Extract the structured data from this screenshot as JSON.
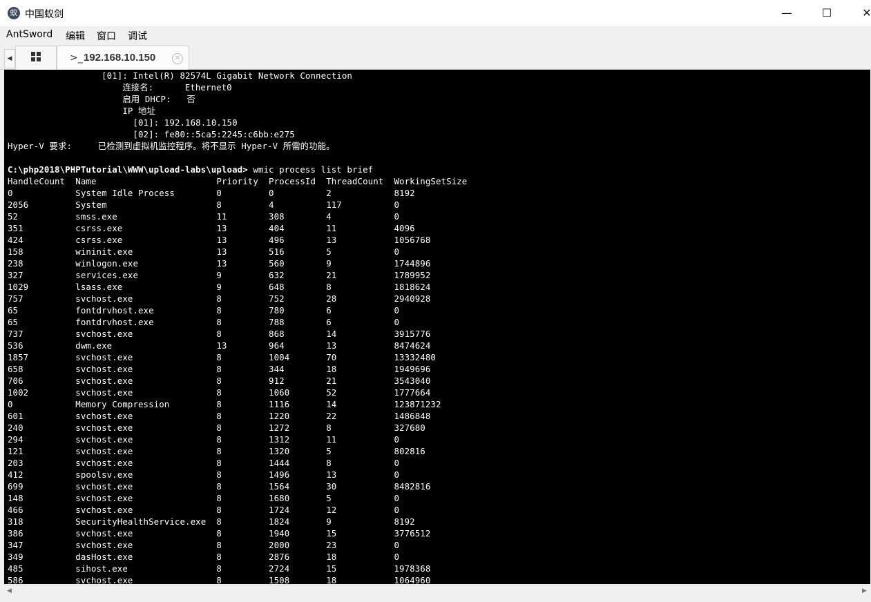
{
  "window": {
    "title": "中国蚁剑",
    "app_icon": "antsword-logo-icon",
    "minimize": "—",
    "maximize": "☐",
    "close": "✕"
  },
  "menu": [
    "AntSword",
    "编辑",
    "窗口",
    "调试"
  ],
  "tabs": {
    "scroll_left": "◀",
    "home_icon": "grid-icon",
    "terminal_tab": {
      "prompt": ">_",
      "label": "192.168.10.150",
      "close": "✕"
    }
  },
  "terminal": {
    "preamble": [
      "                  [01]: Intel(R) 82574L Gigabit Network Connection",
      "                      连接名:      Ethernet0",
      "                      启用 DHCP:   否",
      "                      IP 地址",
      "                        [01]: 192.168.10.150",
      "                        [02]: fe80::5ca5:2245:c6bb:e275",
      "Hyper-V 要求:     已检测到虚拟机监控程序。将不显示 Hyper-V 所需的功能。",
      ""
    ],
    "prompt_path": "C:\\php2018\\PHPTutorial\\WWW\\upload-labs\\upload>",
    "command": " wmic process list brief",
    "columns": [
      "HandleCount",
      "Name",
      "Priority",
      "ProcessId",
      "ThreadCount",
      "WorkingSetSize"
    ],
    "rows": [
      [
        "0",
        "System Idle Process",
        "0",
        "0",
        "2",
        "8192"
      ],
      [
        "2056",
        "System",
        "8",
        "4",
        "117",
        "0"
      ],
      [
        "52",
        "smss.exe",
        "11",
        "308",
        "4",
        "0"
      ],
      [
        "351",
        "csrss.exe",
        "13",
        "404",
        "11",
        "4096"
      ],
      [
        "424",
        "csrss.exe",
        "13",
        "496",
        "13",
        "1056768"
      ],
      [
        "158",
        "wininit.exe",
        "13",
        "516",
        "5",
        "0"
      ],
      [
        "238",
        "winlogon.exe",
        "13",
        "560",
        "9",
        "1744896"
      ],
      [
        "327",
        "services.exe",
        "9",
        "632",
        "21",
        "1789952"
      ],
      [
        "1029",
        "lsass.exe",
        "9",
        "648",
        "8",
        "1818624"
      ],
      [
        "757",
        "svchost.exe",
        "8",
        "752",
        "28",
        "2940928"
      ],
      [
        "65",
        "fontdrvhost.exe",
        "8",
        "780",
        "6",
        "0"
      ],
      [
        "65",
        "fontdrvhost.exe",
        "8",
        "788",
        "6",
        "0"
      ],
      [
        "737",
        "svchost.exe",
        "8",
        "868",
        "14",
        "3915776"
      ],
      [
        "536",
        "dwm.exe",
        "13",
        "964",
        "13",
        "8474624"
      ],
      [
        "1857",
        "svchost.exe",
        "8",
        "1004",
        "70",
        "13332480"
      ],
      [
        "658",
        "svchost.exe",
        "8",
        "344",
        "18",
        "1949696"
      ],
      [
        "706",
        "svchost.exe",
        "8",
        "912",
        "21",
        "3543040"
      ],
      [
        "1002",
        "svchost.exe",
        "8",
        "1060",
        "52",
        "1777664"
      ],
      [
        "0",
        "Memory Compression",
        "8",
        "1116",
        "14",
        "123871232"
      ],
      [
        "601",
        "svchost.exe",
        "8",
        "1220",
        "22",
        "1486848"
      ],
      [
        "240",
        "svchost.exe",
        "8",
        "1272",
        "8",
        "327680"
      ],
      [
        "294",
        "svchost.exe",
        "8",
        "1312",
        "11",
        "0"
      ],
      [
        "121",
        "svchost.exe",
        "8",
        "1320",
        "5",
        "802816"
      ],
      [
        "203",
        "svchost.exe",
        "8",
        "1444",
        "8",
        "0"
      ],
      [
        "412",
        "spoolsv.exe",
        "8",
        "1496",
        "13",
        "0"
      ],
      [
        "699",
        "svchost.exe",
        "8",
        "1564",
        "30",
        "8482816"
      ],
      [
        "148",
        "svchost.exe",
        "8",
        "1680",
        "5",
        "0"
      ],
      [
        "466",
        "svchost.exe",
        "8",
        "1724",
        "12",
        "0"
      ],
      [
        "318",
        "SecurityHealthService.exe",
        "8",
        "1824",
        "9",
        "8192"
      ],
      [
        "386",
        "svchost.exe",
        "8",
        "1940",
        "15",
        "3776512"
      ],
      [
        "347",
        "svchost.exe",
        "8",
        "2000",
        "23",
        "0"
      ],
      [
        "349",
        "dasHost.exe",
        "8",
        "2876",
        "18",
        "0"
      ],
      [
        "485",
        "sihost.exe",
        "8",
        "2724",
        "15",
        "1978368"
      ],
      [
        "586",
        "svchost.exe",
        "8",
        "1508",
        "18",
        "1064960"
      ]
    ]
  },
  "scrollbar": {
    "left_arrow": "◀",
    "right_arrow": "▶"
  }
}
